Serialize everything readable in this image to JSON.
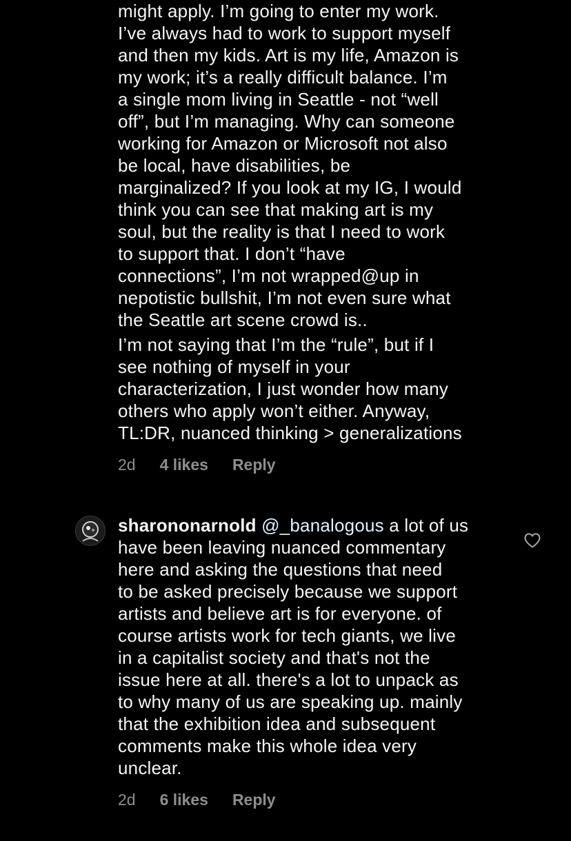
{
  "comment1": {
    "lines": [
      "might apply. I’m going to enter my work.",
      "I’ve always had to work to support myself",
      "and then my kids. Art is my life, Amazon is",
      "my work; it’s a really difficult balance. I’m",
      "a single mom living in Seattle - not “well",
      "off”, but I’m managing. Why can someone",
      "working for Amazon or Microsoft not also",
      "be local, have disabilities, be",
      "marginalized? If you look at my IG, I would",
      "think you can see that making art is my",
      "soul, but the reality is that I need to work",
      "to support that. I don’t “have",
      "connections”, I’m not wrapped@up in",
      "nepotistic bullshit, I’m not even sure what",
      "the Seattle art scene crowd is.."
    ],
    "lines2": [
      "I’m not saying that I’m the “rule”, but if I",
      "see nothing of myself in your",
      "characterization, I just wonder how many",
      "others who apply won’t either. Anyway,",
      "TL:DR, nuanced thinking > generalizations"
    ],
    "time": "2d",
    "likes": "4 likes",
    "reply": "Reply"
  },
  "comment2": {
    "username": "sharononarnold",
    "mention": "@_banalogous",
    "first_line_rest": " a lot of us",
    "lines": [
      "have been leaving nuanced commentary",
      "here and asking the questions that need",
      "to be asked precisely because we support",
      "artists and believe art is for everyone. of",
      "course artists work for tech giants, we live",
      "in a capitalist society and that's not the",
      "issue here at all. there's a lot to unpack as",
      "to why many of us are speaking up. mainly",
      "that the exhibition idea and subsequent",
      "comments make this whole idea very",
      "unclear."
    ],
    "time": "2d",
    "likes": "6 likes",
    "reply": "Reply"
  },
  "icons": {
    "like": "heart-outline-icon",
    "avatar": "profile-avatar"
  },
  "colors": {
    "background": "#000000",
    "text": "#f5f5f5",
    "meta": "#8e8e8e",
    "mention": "#e0f1ff"
  }
}
